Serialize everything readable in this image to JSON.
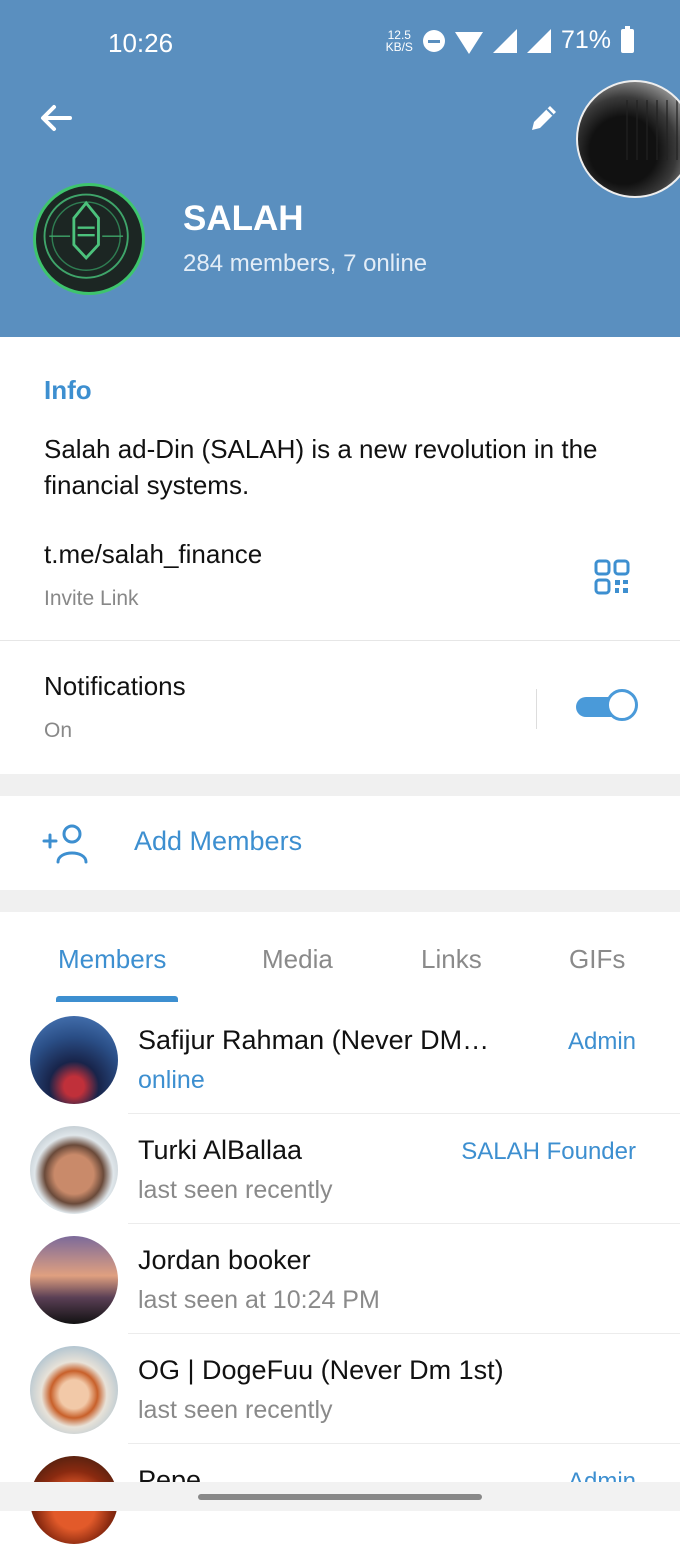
{
  "status_bar": {
    "time": "10:26",
    "net_speed": "12.5",
    "net_unit": "KB/S",
    "battery": "71%"
  },
  "group": {
    "name": "SALAH",
    "subtitle": "284 members, 7 online"
  },
  "info": {
    "heading": "Info",
    "description": "Salah ad-Din (SALAH) is a new revolution in the financial systems.",
    "link": "t.me/salah_finance",
    "link_label": "Invite Link"
  },
  "notifications": {
    "label": "Notifications",
    "state": "On",
    "enabled": true
  },
  "add_members": {
    "label": "Add Members"
  },
  "tabs": [
    {
      "label": "Members",
      "active": true
    },
    {
      "label": "Media",
      "active": false
    },
    {
      "label": "Links",
      "active": false
    },
    {
      "label": "GIFs",
      "active": false
    }
  ],
  "members": [
    {
      "name": "Safijur Rahman (Never DM…",
      "status": "online",
      "role": "Admin",
      "online": true
    },
    {
      "name": "Turki AlBallaa",
      "status": "last seen recently",
      "role": "SALAH Founder",
      "online": false
    },
    {
      "name": "Jordan booker",
      "status": "last seen at 10:24 PM",
      "role": "",
      "online": false
    },
    {
      "name": "OG | DogeFuu (Never Dm 1st)",
      "status": "last seen recently",
      "role": "",
      "online": false
    },
    {
      "name": "Pepe",
      "status": "",
      "role": "Admin",
      "online": false
    }
  ],
  "colors": {
    "header": "#5a8fbf",
    "accent": "#3d8fd0",
    "online_ring": "#3ec46d"
  }
}
